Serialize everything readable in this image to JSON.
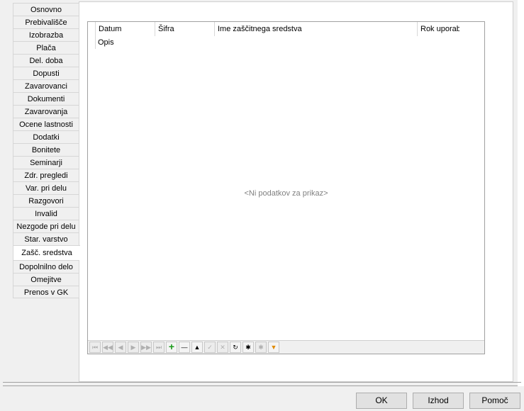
{
  "tabs": [
    {
      "label": "Osnovno"
    },
    {
      "label": "Prebivališče"
    },
    {
      "label": "Izobrazba"
    },
    {
      "label": "Plača"
    },
    {
      "label": "Del. doba"
    },
    {
      "label": "Dopusti"
    },
    {
      "label": "Zavarovanci"
    },
    {
      "label": "Dokumenti"
    },
    {
      "label": "Zavarovanja"
    },
    {
      "label": "Ocene lastnosti"
    },
    {
      "label": "Dodatki"
    },
    {
      "label": "Bonitete"
    },
    {
      "label": "Seminarji"
    },
    {
      "label": "Zdr. pregledi"
    },
    {
      "label": "Var. pri delu"
    },
    {
      "label": "Razgovori"
    },
    {
      "label": "Invalid"
    },
    {
      "label": "Nezgode pri delu"
    },
    {
      "label": "Star. varstvo"
    },
    {
      "label": "Zašč. sredstva"
    },
    {
      "label": "Dopolnilno delo"
    },
    {
      "label": "Omejitve"
    },
    {
      "label": "Prenos v GK"
    }
  ],
  "active_tab": "Zašč. sredstva",
  "grid": {
    "columns": [
      {
        "label": "Datum"
      },
      {
        "label": "Šifra"
      },
      {
        "label": "Ime zaščitnega sredstva"
      },
      {
        "label": "Rok uporabe"
      }
    ],
    "second_row_label": "Opis",
    "empty_text": "<Ni podatkov za prikaz>"
  },
  "navigator": {
    "buttons": [
      {
        "name": "first-page",
        "glyph": "⏮"
      },
      {
        "name": "prev-page",
        "glyph": "◀◀"
      },
      {
        "name": "prev",
        "glyph": "◀"
      },
      {
        "name": "next",
        "glyph": "▶"
      },
      {
        "name": "next-page",
        "glyph": "▶▶"
      },
      {
        "name": "last-page",
        "glyph": "⏭"
      },
      {
        "name": "add",
        "glyph": "+"
      },
      {
        "name": "delete",
        "glyph": "—"
      },
      {
        "name": "edit",
        "glyph": "▲"
      },
      {
        "name": "post",
        "glyph": "✓"
      },
      {
        "name": "cancel",
        "glyph": "✕"
      },
      {
        "name": "refresh",
        "glyph": "↻"
      },
      {
        "name": "save-bookmark",
        "glyph": "✱"
      },
      {
        "name": "goto-bookmark",
        "glyph": "✱"
      },
      {
        "name": "filter",
        "glyph": "▼"
      }
    ]
  },
  "buttons": {
    "ok": "OK",
    "exit": "Izhod",
    "help": "Pomoč"
  }
}
